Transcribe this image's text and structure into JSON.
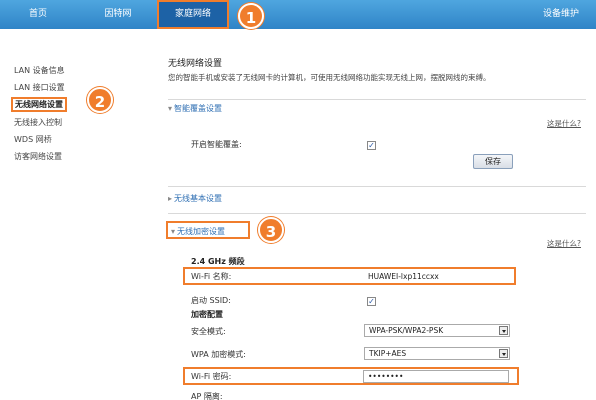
{
  "topnav": {
    "home": "首页",
    "internet": "因特网",
    "home_network": "家庭网络",
    "device_maintenance": "设备维护"
  },
  "markers": {
    "m1": "1",
    "m2": "2",
    "m3": "3"
  },
  "sidebar": {
    "items": [
      {
        "label": "LAN 设备信息"
      },
      {
        "label": "LAN 接口设置"
      },
      {
        "label": "无线网络设置"
      },
      {
        "label": "无线接入控制"
      },
      {
        "label": "WDS 网桥"
      },
      {
        "label": "访客网络设置"
      }
    ]
  },
  "main": {
    "title": "无线网络设置",
    "description": "您的智能手机或安装了无线网卡的计算机，可使用无线网络功能实现无线上网，摆脱网线的束缚。",
    "smart_coverage": {
      "heading": "智能覆盖设置",
      "help": "这是什么?",
      "enable_label": "开启智能覆盖:",
      "enabled": true,
      "save": "保存"
    },
    "basic": {
      "heading": "无线基本设置"
    },
    "encryption": {
      "heading": "无线加密设置",
      "help": "这是什么?",
      "band": "2.4 GHz 频段",
      "wifi_name_label": "Wi-Fi 名称:",
      "wifi_name_value": "HUAWEI-lxp11ccxx",
      "ssid_label": "启动 SSID:",
      "ssid_enabled": true,
      "enc_config": "加密配置",
      "security_mode_label": "安全模式:",
      "security_mode_value": "WPA-PSK/WPA2-PSK",
      "wpa_mode_label": "WPA 加密模式:",
      "wpa_mode_value": "TKIP+AES",
      "password_label": "Wi-Fi 密码:",
      "password_value": "••••••••",
      "ap_isolation_label": "AP 隔离:"
    }
  },
  "colors": {
    "accent": "#f07d2c",
    "nav": "#2f84c7",
    "link": "#2f6fb3"
  }
}
